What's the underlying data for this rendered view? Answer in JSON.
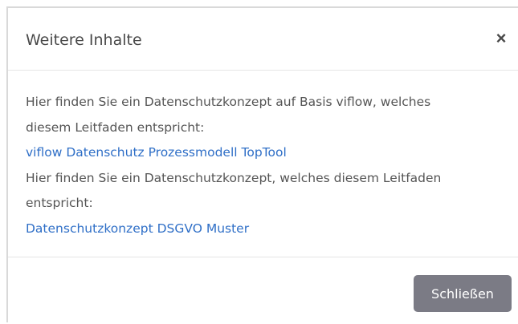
{
  "dialog": {
    "title": "Weitere Inhalte",
    "close_glyph": "×",
    "body": {
      "line1": "Hier finden Sie ein Datenschutzkonzept auf Basis viflow, welches",
      "line2": "diesem Leitfaden entspricht:",
      "link1": "viflow Datenschutz Prozessmodell TopTool",
      "line3": "Hier finden Sie ein Datenschutzkonzept, welches diesem Leitfaden",
      "line4": "entspricht:",
      "link2": "Datenschutzkonzept DSGVO Muster"
    },
    "footer": {
      "close_label": "Schließen"
    }
  },
  "colors": {
    "link": "#2f6fc7",
    "text": "#555555",
    "button_bg": "#7b7b85"
  },
  "icons": {
    "close": "close-icon"
  }
}
